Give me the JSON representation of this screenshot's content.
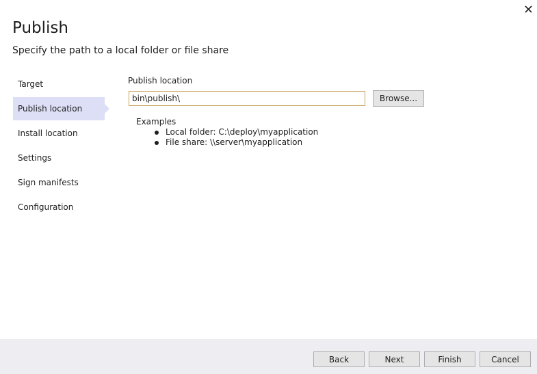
{
  "dialog": {
    "title": "Publish",
    "subtitle": "Specify the path to a local folder or file share",
    "close_icon": "close-icon"
  },
  "nav": {
    "items": [
      {
        "label": "Target"
      },
      {
        "label": "Publish location"
      },
      {
        "label": "Install location"
      },
      {
        "label": "Settings"
      },
      {
        "label": "Sign manifests"
      },
      {
        "label": "Configuration"
      }
    ],
    "active": "Publish location"
  },
  "publish_location": {
    "label": "Publish location",
    "value": "bin\\publish\\",
    "browse_label": "Browse...",
    "examples_title": "Examples",
    "examples": [
      "Local folder:  C:\\deploy\\myapplication",
      "File share: \\\\server\\myapplication"
    ]
  },
  "footer": {
    "back_label": "Back",
    "next_label": "Next",
    "finish_label": "Finish",
    "cancel_label": "Cancel"
  },
  "colors": {
    "active_nav_bg": "#dcdff5",
    "input_border": "#c5a35a",
    "footer_bg": "#eeeef2"
  }
}
